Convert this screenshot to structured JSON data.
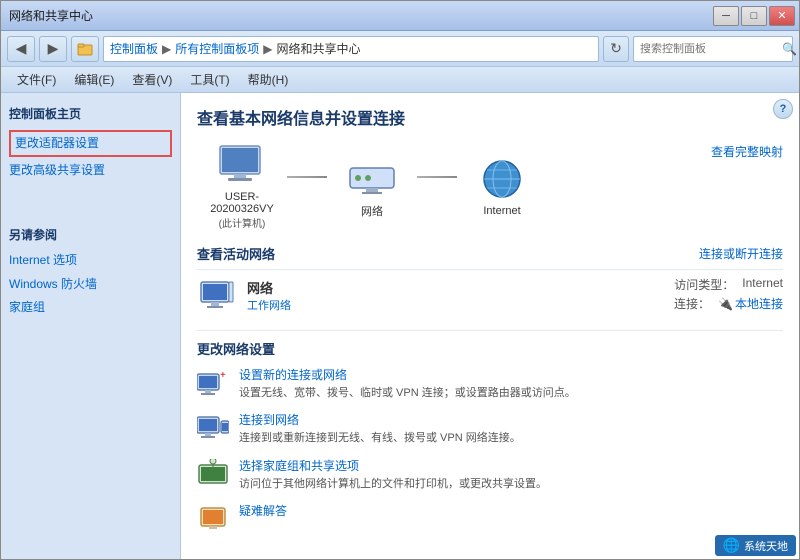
{
  "window": {
    "title": "网络和共享中心",
    "title_bar_label": "网络和共享中心"
  },
  "title_bar": {
    "minimize": "─",
    "maximize": "□",
    "close": "✕"
  },
  "address_bar": {
    "back_icon": "◀",
    "forward_icon": "▶",
    "breadcrumb": [
      {
        "label": "控制面板",
        "sep": "▶"
      },
      {
        "label": "所有控制面板项",
        "sep": "▶"
      },
      {
        "label": "网络和共享中心",
        "sep": ""
      }
    ],
    "refresh_icon": "↻",
    "search_placeholder": "搜索控制面板",
    "search_icon": "🔍"
  },
  "menu_bar": {
    "items": [
      "文件(F)",
      "编辑(E)",
      "查看(V)",
      "工具(T)",
      "帮助(H)"
    ]
  },
  "sidebar": {
    "main_section_title": "控制面板主页",
    "links": [
      {
        "label": "更改适配器设置",
        "highlighted": true
      },
      {
        "label": "更改高级共享设置",
        "highlighted": false
      }
    ],
    "also_see_title": "另请参阅",
    "also_see_links": [
      "Internet 选项",
      "Windows 防火墙",
      "家庭组"
    ]
  },
  "content": {
    "page_title": "查看基本网络信息并设置连接",
    "view_full_map_label": "查看完整映射",
    "network_diagram": [
      {
        "label": "USER-20200326VY",
        "sublabel": "(此计算机)",
        "icon": "🖥"
      },
      {
        "connector": true
      },
      {
        "label": "网络",
        "sublabel": "",
        "icon": "🔌"
      },
      {
        "connector": true
      },
      {
        "label": "Internet",
        "sublabel": "",
        "icon": "🌐"
      }
    ],
    "active_network_title": "查看活动网络",
    "connect_or_disconnect": "连接或断开连接",
    "active_network": {
      "name": "网络",
      "type": "工作网络",
      "access_type_label": "访问类型：",
      "access_type_value": "Internet",
      "connection_label": "连接：",
      "connection_value": "本地连接",
      "connection_icon": "🔌"
    },
    "change_settings_title": "更改网络设置",
    "settings": [
      {
        "icon": "🖧",
        "link": "设置新的连接或网络",
        "desc": "设置无线、宽带、拨号、临时或 VPN 连接；或设置路由器或访问点。"
      },
      {
        "icon": "🔗",
        "link": "连接到网络",
        "desc": "连接到或重新连接到无线、有线、拨号或 VPN 网络连接。"
      },
      {
        "icon": "🏠",
        "link": "选择家庭组和共享选项",
        "desc": "访问位于其他网络计算机上的文件和打印机，或更改共享设置。"
      },
      {
        "icon": "🔧",
        "link": "疑难解答",
        "desc": ""
      }
    ]
  },
  "watermark": {
    "icon": "🌐",
    "text": "系统天地"
  }
}
